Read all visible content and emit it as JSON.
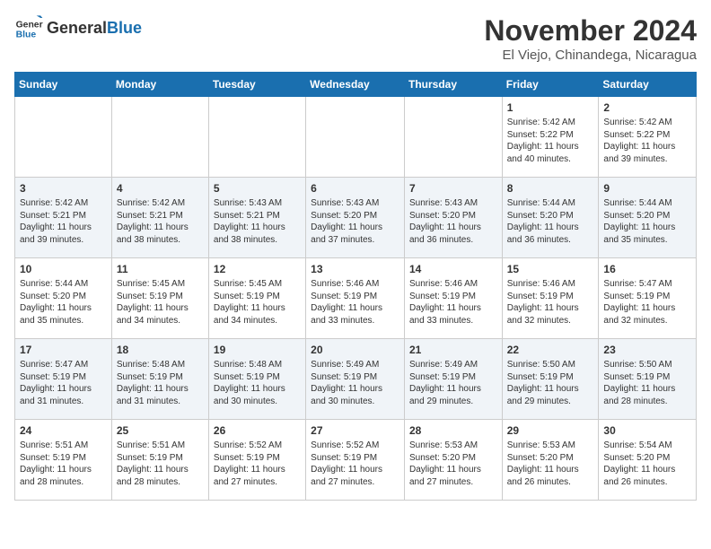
{
  "logo": {
    "general": "General",
    "blue": "Blue"
  },
  "title": "November 2024",
  "location": "El Viejo, Chinandega, Nicaragua",
  "days_of_week": [
    "Sunday",
    "Monday",
    "Tuesday",
    "Wednesday",
    "Thursday",
    "Friday",
    "Saturday"
  ],
  "weeks": [
    [
      {
        "day": "",
        "content": ""
      },
      {
        "day": "",
        "content": ""
      },
      {
        "day": "",
        "content": ""
      },
      {
        "day": "",
        "content": ""
      },
      {
        "day": "",
        "content": ""
      },
      {
        "day": "1",
        "content": "Sunrise: 5:42 AM\nSunset: 5:22 PM\nDaylight: 11 hours and 40 minutes."
      },
      {
        "day": "2",
        "content": "Sunrise: 5:42 AM\nSunset: 5:22 PM\nDaylight: 11 hours and 39 minutes."
      }
    ],
    [
      {
        "day": "3",
        "content": "Sunrise: 5:42 AM\nSunset: 5:21 PM\nDaylight: 11 hours and 39 minutes."
      },
      {
        "day": "4",
        "content": "Sunrise: 5:42 AM\nSunset: 5:21 PM\nDaylight: 11 hours and 38 minutes."
      },
      {
        "day": "5",
        "content": "Sunrise: 5:43 AM\nSunset: 5:21 PM\nDaylight: 11 hours and 38 minutes."
      },
      {
        "day": "6",
        "content": "Sunrise: 5:43 AM\nSunset: 5:20 PM\nDaylight: 11 hours and 37 minutes."
      },
      {
        "day": "7",
        "content": "Sunrise: 5:43 AM\nSunset: 5:20 PM\nDaylight: 11 hours and 36 minutes."
      },
      {
        "day": "8",
        "content": "Sunrise: 5:44 AM\nSunset: 5:20 PM\nDaylight: 11 hours and 36 minutes."
      },
      {
        "day": "9",
        "content": "Sunrise: 5:44 AM\nSunset: 5:20 PM\nDaylight: 11 hours and 35 minutes."
      }
    ],
    [
      {
        "day": "10",
        "content": "Sunrise: 5:44 AM\nSunset: 5:20 PM\nDaylight: 11 hours and 35 minutes."
      },
      {
        "day": "11",
        "content": "Sunrise: 5:45 AM\nSunset: 5:19 PM\nDaylight: 11 hours and 34 minutes."
      },
      {
        "day": "12",
        "content": "Sunrise: 5:45 AM\nSunset: 5:19 PM\nDaylight: 11 hours and 34 minutes."
      },
      {
        "day": "13",
        "content": "Sunrise: 5:46 AM\nSunset: 5:19 PM\nDaylight: 11 hours and 33 minutes."
      },
      {
        "day": "14",
        "content": "Sunrise: 5:46 AM\nSunset: 5:19 PM\nDaylight: 11 hours and 33 minutes."
      },
      {
        "day": "15",
        "content": "Sunrise: 5:46 AM\nSunset: 5:19 PM\nDaylight: 11 hours and 32 minutes."
      },
      {
        "day": "16",
        "content": "Sunrise: 5:47 AM\nSunset: 5:19 PM\nDaylight: 11 hours and 32 minutes."
      }
    ],
    [
      {
        "day": "17",
        "content": "Sunrise: 5:47 AM\nSunset: 5:19 PM\nDaylight: 11 hours and 31 minutes."
      },
      {
        "day": "18",
        "content": "Sunrise: 5:48 AM\nSunset: 5:19 PM\nDaylight: 11 hours and 31 minutes."
      },
      {
        "day": "19",
        "content": "Sunrise: 5:48 AM\nSunset: 5:19 PM\nDaylight: 11 hours and 30 minutes."
      },
      {
        "day": "20",
        "content": "Sunrise: 5:49 AM\nSunset: 5:19 PM\nDaylight: 11 hours and 30 minutes."
      },
      {
        "day": "21",
        "content": "Sunrise: 5:49 AM\nSunset: 5:19 PM\nDaylight: 11 hours and 29 minutes."
      },
      {
        "day": "22",
        "content": "Sunrise: 5:50 AM\nSunset: 5:19 PM\nDaylight: 11 hours and 29 minutes."
      },
      {
        "day": "23",
        "content": "Sunrise: 5:50 AM\nSunset: 5:19 PM\nDaylight: 11 hours and 28 minutes."
      }
    ],
    [
      {
        "day": "24",
        "content": "Sunrise: 5:51 AM\nSunset: 5:19 PM\nDaylight: 11 hours and 28 minutes."
      },
      {
        "day": "25",
        "content": "Sunrise: 5:51 AM\nSunset: 5:19 PM\nDaylight: 11 hours and 28 minutes."
      },
      {
        "day": "26",
        "content": "Sunrise: 5:52 AM\nSunset: 5:19 PM\nDaylight: 11 hours and 27 minutes."
      },
      {
        "day": "27",
        "content": "Sunrise: 5:52 AM\nSunset: 5:19 PM\nDaylight: 11 hours and 27 minutes."
      },
      {
        "day": "28",
        "content": "Sunrise: 5:53 AM\nSunset: 5:20 PM\nDaylight: 11 hours and 27 minutes."
      },
      {
        "day": "29",
        "content": "Sunrise: 5:53 AM\nSunset: 5:20 PM\nDaylight: 11 hours and 26 minutes."
      },
      {
        "day": "30",
        "content": "Sunrise: 5:54 AM\nSunset: 5:20 PM\nDaylight: 11 hours and 26 minutes."
      }
    ]
  ]
}
